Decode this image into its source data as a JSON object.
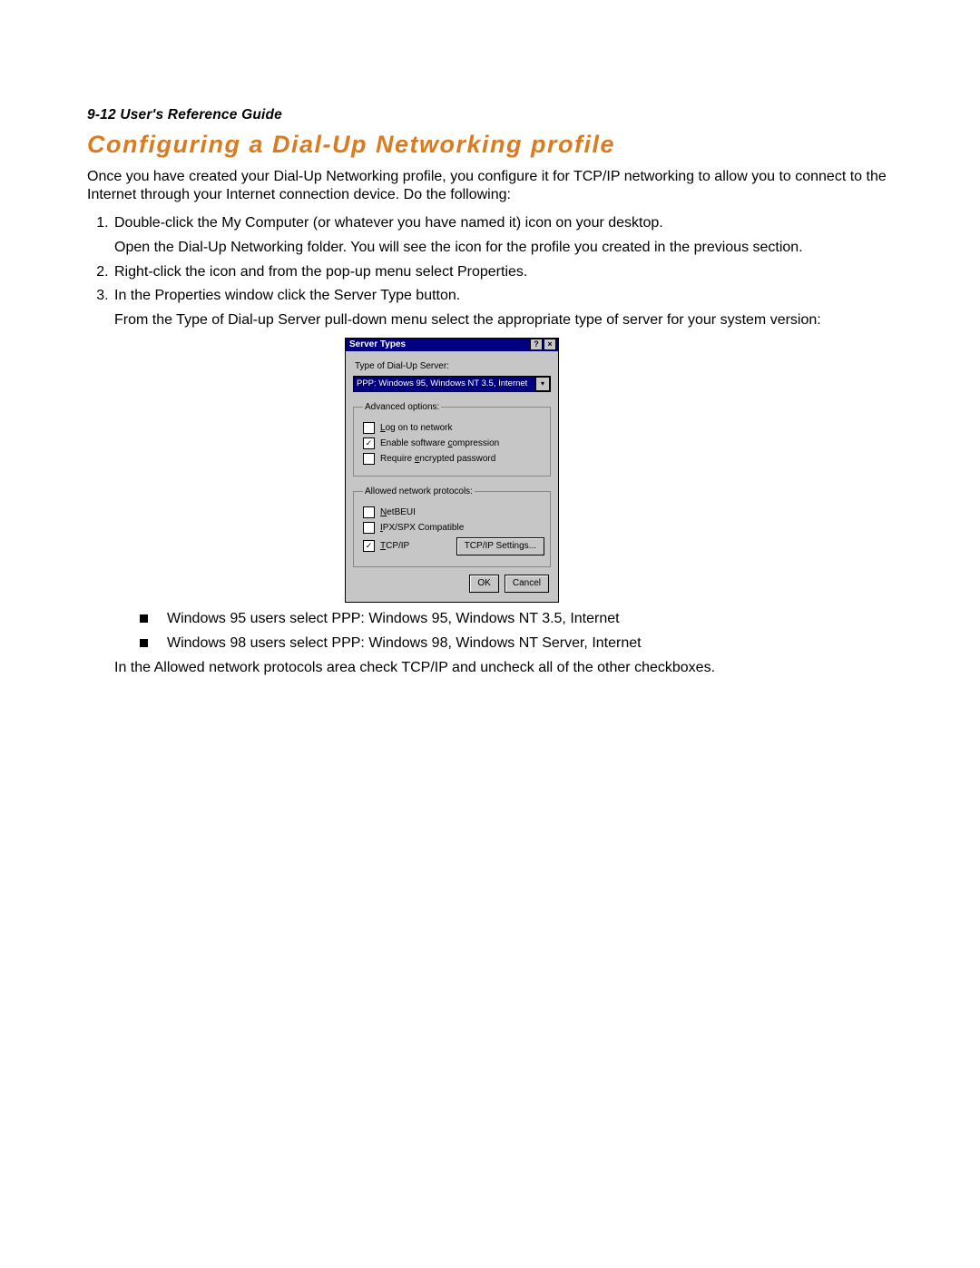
{
  "header": "9-12  User's Reference Guide",
  "title": "Configuring a Dial-Up Networking profile",
  "intro": "Once you have created your Dial-Up Networking profile, you configure it for TCP/IP networking to allow you to connect to the Internet through your Internet connection device. Do the following:",
  "steps": {
    "s1a": "Double-click the My Computer (or whatever you have named it) icon on your desktop.",
    "s1b": "Open the Dial-Up Networking folder. You will see the icon for the profile you created in the previous section.",
    "s2": "Right-click the icon and from the pop-up menu select Properties.",
    "s3a": "In the Properties window click the Server Type button.",
    "s3b": "From the Type of Dial-up Server pull-down menu select the appropriate type of server for your system version:"
  },
  "dialog": {
    "title": "Server Types",
    "help": "?",
    "close": "×",
    "type_label": "Type of Dial-Up Server:",
    "combo_value": "PPP: Windows 95, Windows NT 3.5, Internet",
    "advanced_legend": "Advanced options:",
    "opt_logon": "Log on to network",
    "opt_compress_pre": "Enable software ",
    "opt_compress_ul": "c",
    "opt_compress_post": "ompression",
    "opt_encrypt_pre": "Require ",
    "opt_encrypt_ul": "e",
    "opt_encrypt_post": "ncrypted password",
    "protocols_legend": "Allowed network protocols:",
    "proto_netbeui": "NetBEUI",
    "proto_ipx": "IPX/SPX Compatible",
    "proto_tcpip": "TCP/IP",
    "tcpip_settings": "TCP/IP Settings...",
    "ok": "OK",
    "cancel": "Cancel"
  },
  "bullets": {
    "b1": "Windows 95 users select PPP: Windows 95, Windows NT 3.5, Internet",
    "b2": "Windows 98 users select PPP: Windows 98, Windows NT Server, Internet"
  },
  "after_bullets": "In the Allowed network protocols area check TCP/IP and uncheck all of the other checkboxes."
}
